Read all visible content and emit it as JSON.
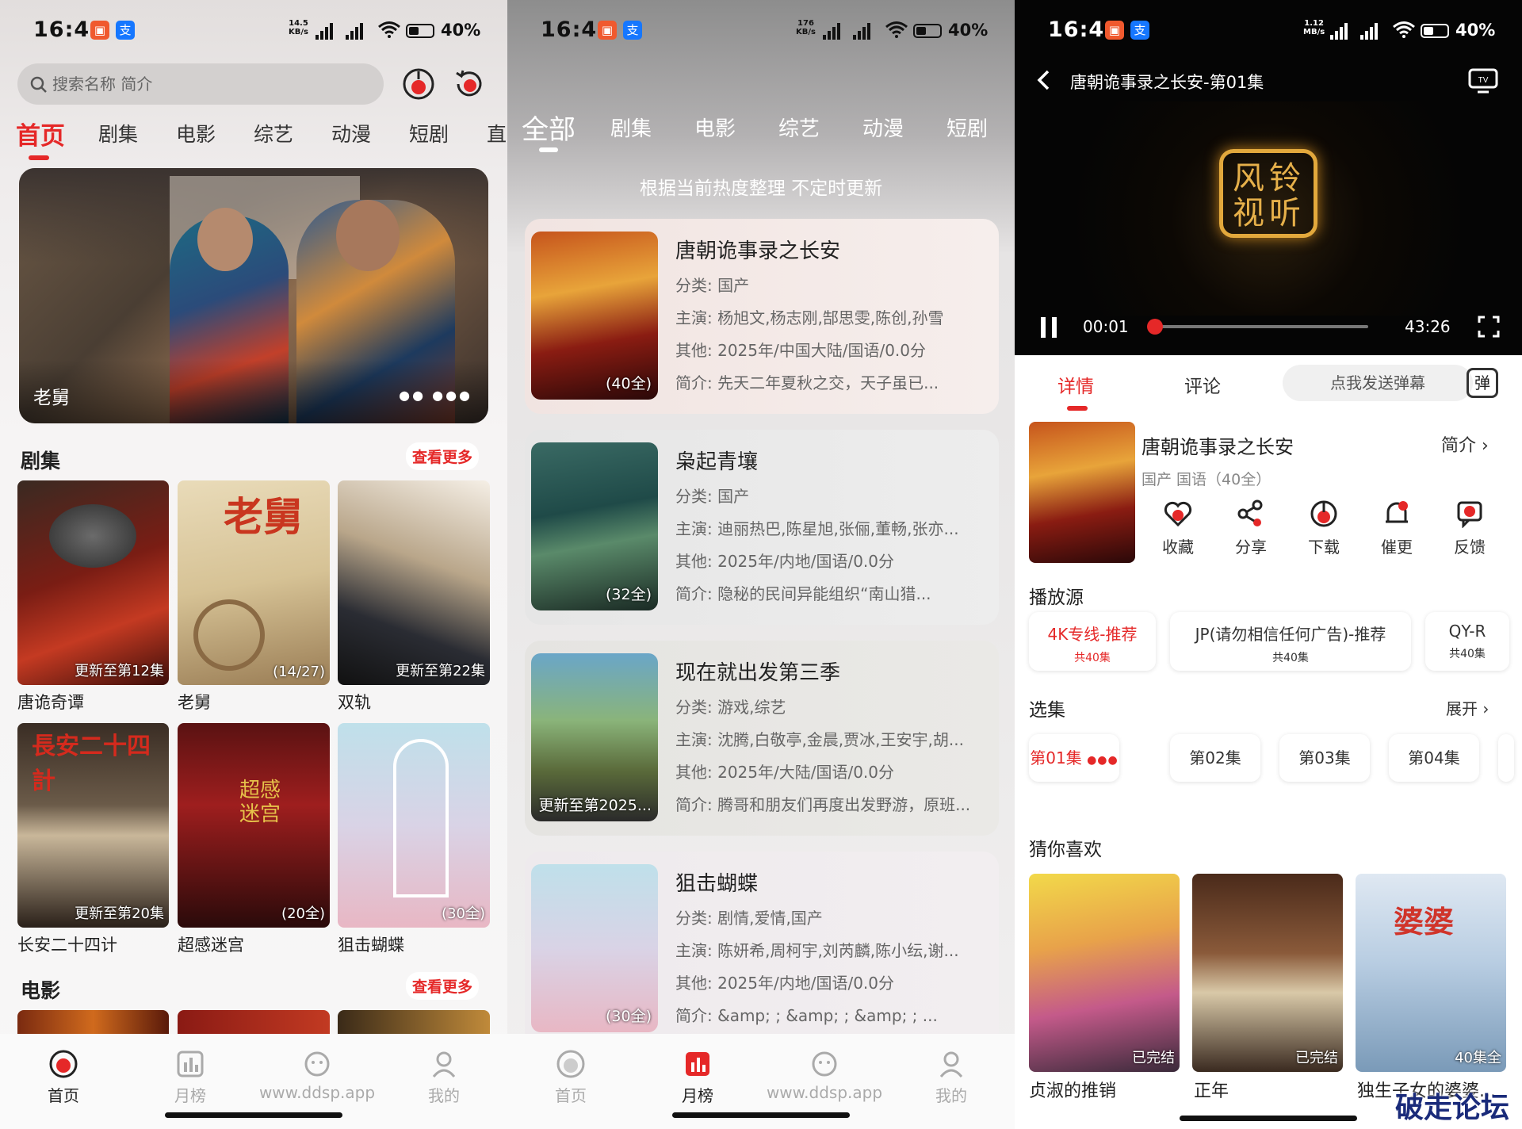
{
  "status_bar": {
    "time": "16:43",
    "battery": "40%",
    "net": "4G",
    "speeds": [
      "14.5\nKB/s",
      "176\nKB/s",
      "1.12\nMB/s"
    ]
  },
  "home": {
    "search_placeholder": "搜索名称 简介",
    "tabs": [
      "首页",
      "剧集",
      "电影",
      "综艺",
      "动漫",
      "短剧",
      "直"
    ],
    "banner_title": "老舅",
    "sections": {
      "series": {
        "title": "剧集",
        "more": "查看更多"
      },
      "movie": {
        "title": "电影",
        "more": "查看更多"
      }
    },
    "posters": [
      {
        "title": "唐诡奇谭",
        "badge": "更新至第12集"
      },
      {
        "title": "老舅",
        "badge": "(14/27)"
      },
      {
        "title": "双轨",
        "badge": "更新至第22集"
      },
      {
        "title": "长安二十四计",
        "badge": "更新至第20集"
      },
      {
        "title": "超感迷宫",
        "badge": "(20全)"
      },
      {
        "title": "狙击蝴蝶",
        "badge": "(30全)"
      }
    ],
    "nav": [
      "首页",
      "月榜",
      "www.ddsp.app",
      "我的"
    ]
  },
  "rank": {
    "tabs": [
      "全部",
      "剧集",
      "电影",
      "综艺",
      "动漫",
      "短剧"
    ],
    "note": "根据当前热度整理 不定时更新",
    "items": [
      {
        "title": "唐朝诡事录之长安",
        "badge": "(40全)",
        "cat": "分类: 国产",
        "cast": "主演: 杨旭文,杨志刚,郜思雯,陈创,孙雪",
        "other": "其他: 2025年/中国大陆/国语/0.0分",
        "intro": "简介:      先天二年夏秋之交，天子虽已..."
      },
      {
        "title": "枭起青壤",
        "badge": "(32全)",
        "cat": "分类: 国产",
        "cast": "主演: 迪丽热巴,陈星旭,张俪,董畅,张亦...",
        "other": "其他: 2025年/内地/国语/0.0分",
        "intro": "简介:      隐秘的民间异能组织“南山猎..."
      },
      {
        "title": "现在就出发第三季",
        "badge": "更新至第2025...",
        "cat": "分类: 游戏,综艺",
        "cast": "主演: 沈腾,白敬亭,金晨,贾冰,王安宇,胡...",
        "other": "其他: 2025年/大陆/国语/0.0分",
        "intro": "简介: 腾哥和朋友们再度出发野游，原班..."
      },
      {
        "title": "狙击蝴蝶",
        "badge": "(30全)",
        "cat": "分类: 剧情,爱情,国产",
        "cast": "主演: 陈妍希,周柯宇,刘芮麟,陈小纭,谢...",
        "other": "其他: 2025年/内地/国语/0.0分",
        "intro": "简介: &amp;    ; &amp;    ; &amp;    ; ..."
      }
    ],
    "nav": [
      "首页",
      "月榜",
      "www.ddsp.app",
      "我的"
    ]
  },
  "detail": {
    "header_title": "唐朝诡事录之长安-第01集",
    "logo_text": "风铃视听",
    "time_current": "00:01",
    "time_total": "43:26",
    "progress": 0.01,
    "tabs": [
      "详情",
      "评论"
    ],
    "danmaku_placeholder": "点我发送弹幕",
    "danmaku_icon": "弹",
    "show_title": "唐朝诡事录之长安",
    "show_meta": "国产  国语（40全）",
    "intro_link": "简介",
    "actions": [
      "收藏",
      "分享",
      "下载",
      "催更",
      "反馈"
    ],
    "source_title": "播放源",
    "sources": [
      {
        "name": "4K专线-推荐",
        "count": "共40集"
      },
      {
        "name": "JP(请勿相信任何广告)-推荐",
        "count": "共40集"
      },
      {
        "name": "QY-R",
        "count": "共40集"
      }
    ],
    "episodes_title": "选集",
    "expand": "展开",
    "episodes": [
      "第01集",
      "第02集",
      "第03集",
      "第04集"
    ],
    "guess_title": "猜你喜欢",
    "guess": [
      {
        "title": "贞淑的推销",
        "badge": "已完结"
      },
      {
        "title": "正年",
        "badge": "已完结"
      },
      {
        "title": "独生子女的婆婆...",
        "badge": "40集全"
      }
    ],
    "watermark": "破走论坛"
  },
  "colors": {
    "accent": "#e52828"
  }
}
